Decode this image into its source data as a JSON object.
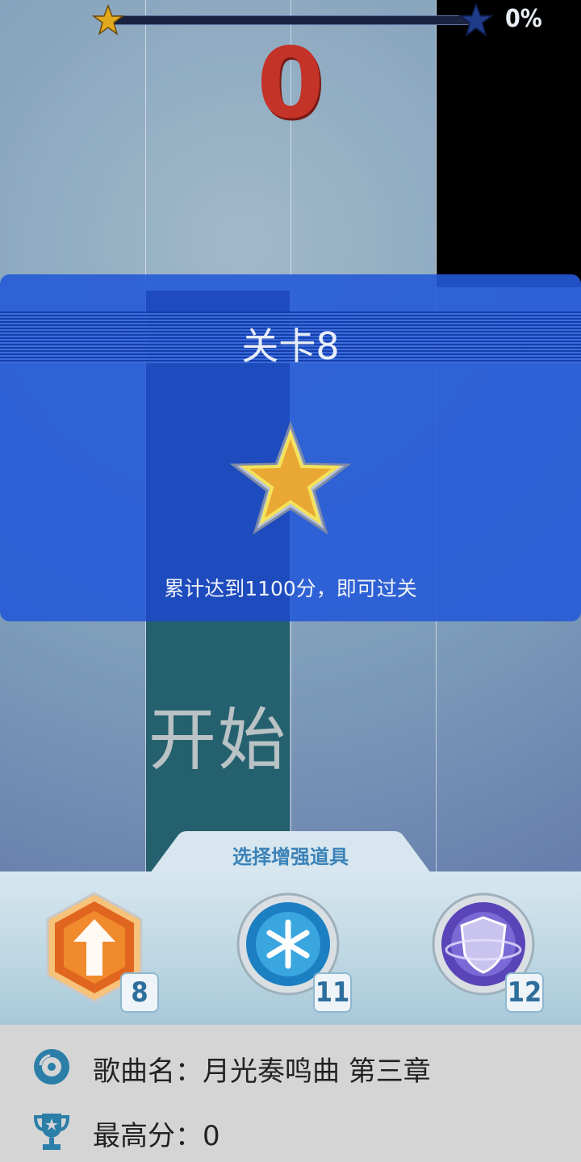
{
  "progress": {
    "percent_label": "0%",
    "fraction": 0.0
  },
  "score": {
    "value": "0"
  },
  "level": {
    "title": "关卡8",
    "requirement": "累计达到1100分，即可过关"
  },
  "start_tile": {
    "label": "开始"
  },
  "boosts": {
    "header": "选择增强道具",
    "items": [
      {
        "icon": "speed-boost-icon",
        "count": "8"
      },
      {
        "icon": "snowflake-freeze-icon",
        "count": "11"
      },
      {
        "icon": "shield-icon",
        "count": "12"
      }
    ]
  },
  "song": {
    "name_label": "歌曲名：",
    "name_value": "月光奏鸣曲 第三章",
    "best_label": "最高分：",
    "best_value": "0"
  },
  "colors": {
    "card_blue": "#2f5ed6",
    "score_red": "#c43328",
    "star_gold": "#f1c232",
    "start_tile": "#25606f"
  }
}
